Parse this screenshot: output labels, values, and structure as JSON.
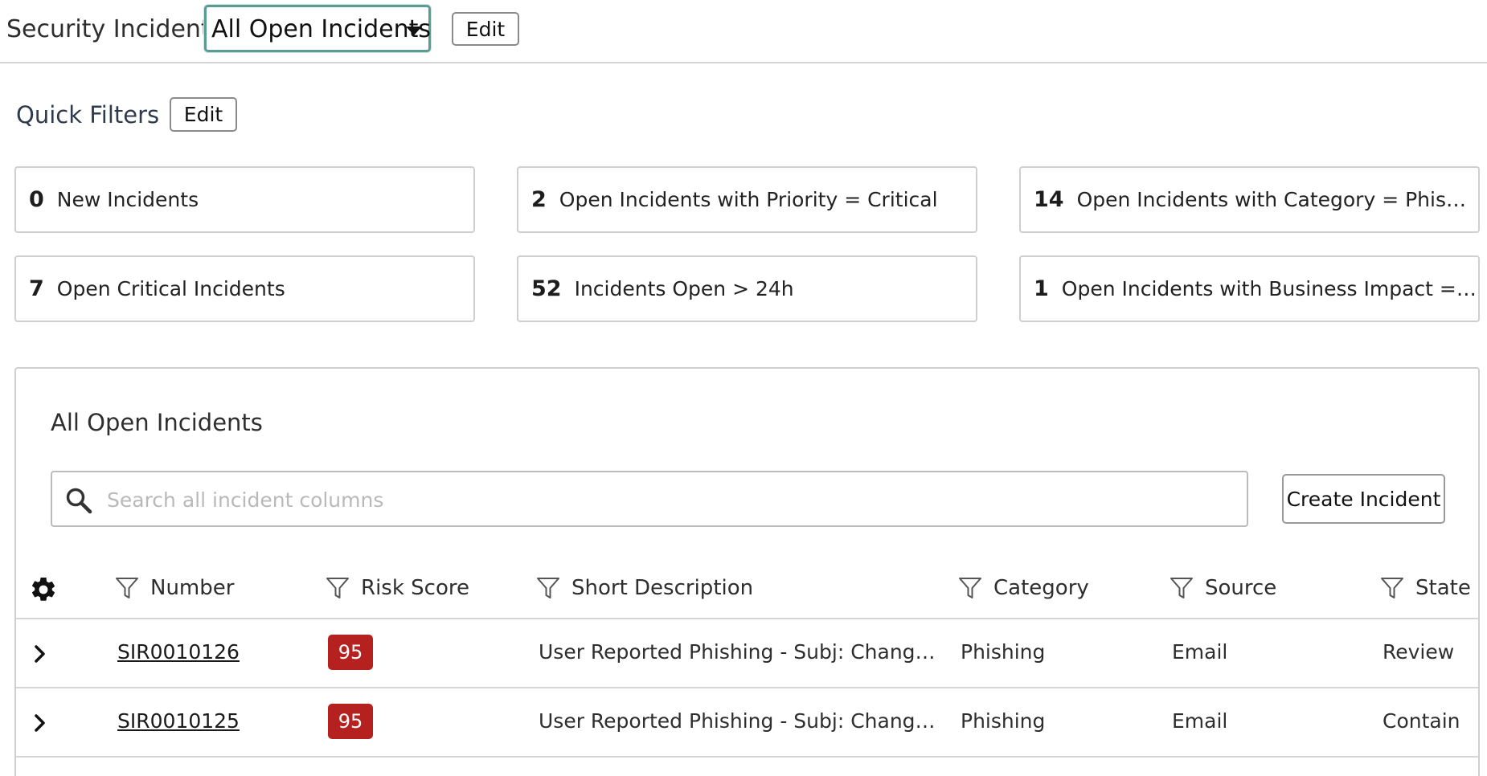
{
  "header": {
    "breadcrumb": "Security Incidents/",
    "view_selected": "All Open Incidents",
    "edit_label": "Edit"
  },
  "quick_filters": {
    "title": "Quick Filters",
    "edit_label": "Edit",
    "cards": [
      {
        "count": "0",
        "label": "New Incidents"
      },
      {
        "count": "2",
        "label": "Open Incidents with Priority = Critical"
      },
      {
        "count": "14",
        "label": "Open Incidents with Category = Phishing"
      },
      {
        "count": "7",
        "label": "Open Critical Incidents"
      },
      {
        "count": "52",
        "label": "Incidents Open > 24h"
      },
      {
        "count": "1",
        "label": "Open Incidents with Business Impact = Critical"
      }
    ]
  },
  "incidents": {
    "title": "All Open Incidents",
    "search_placeholder": "Search all incident columns",
    "create_label": "Create Incident",
    "columns": [
      "Number",
      "Risk Score",
      "Short Description",
      "Category",
      "Source",
      "State"
    ],
    "rows": [
      {
        "number": "SIR0010126",
        "risk": "95",
        "description": "User Reported Phishing - Subj: Change Your Password",
        "category": "Phishing",
        "source": "Email",
        "state": "Review"
      },
      {
        "number": "SIR0010125",
        "risk": "95",
        "description": "User Reported Phishing - Subj: Change Your Password",
        "category": "Phishing",
        "source": "Email",
        "state": "Contain"
      }
    ]
  },
  "colors": {
    "risk_badge": "#b4211f",
    "select_focus": "#5a9c94",
    "border": "#cfcfcf"
  },
  "icons": {
    "search": "search-icon",
    "settings": "gear-icon",
    "filter": "filter-icon",
    "expand": "chevron-right-icon",
    "dropdown": "caret-down-icon"
  }
}
